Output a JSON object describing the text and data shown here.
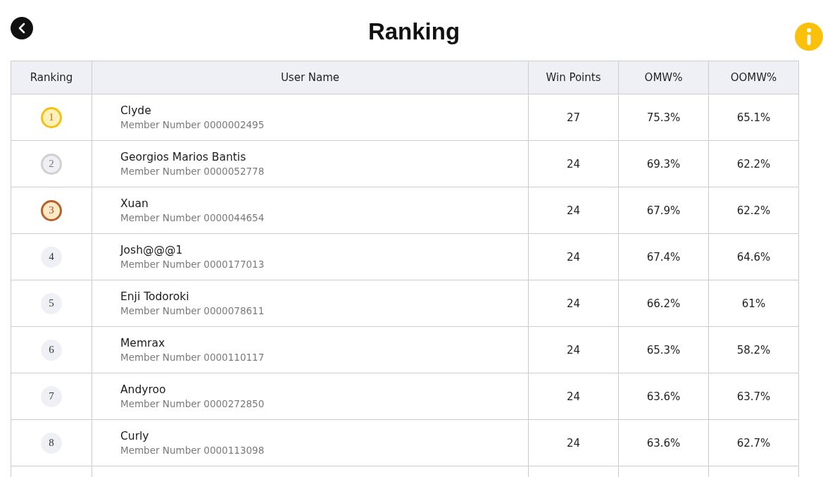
{
  "title": "Ranking",
  "table": {
    "columns": [
      "Ranking",
      "User Name",
      "Win Points",
      "OMW%",
      "OOMW%"
    ],
    "rows": [
      {
        "rank": "1",
        "kind": "gold",
        "name": "Clyde",
        "member": "Member Number 0000002495",
        "win_points": "27",
        "omw": "75.3%",
        "oomw": "65.1%"
      },
      {
        "rank": "2",
        "kind": "silver",
        "name": "Georgios Marios Bantis",
        "member": "Member Number 0000052778",
        "win_points": "24",
        "omw": "69.3%",
        "oomw": "62.2%"
      },
      {
        "rank": "3",
        "kind": "bronze",
        "name": "Xuan",
        "member": "Member Number 0000044654",
        "win_points": "24",
        "omw": "67.9%",
        "oomw": "62.2%"
      },
      {
        "rank": "4",
        "kind": "plain",
        "name": "Josh@@@1",
        "member": "Member Number 0000177013",
        "win_points": "24",
        "omw": "67.4%",
        "oomw": "64.6%"
      },
      {
        "rank": "5",
        "kind": "plain",
        "name": "Enji Todoroki",
        "member": "Member Number 0000078611",
        "win_points": "24",
        "omw": "66.2%",
        "oomw": "61%"
      },
      {
        "rank": "6",
        "kind": "plain",
        "name": "Memrax",
        "member": "Member Number 0000110117",
        "win_points": "24",
        "omw": "65.3%",
        "oomw": "58.2%"
      },
      {
        "rank": "7",
        "kind": "plain",
        "name": "Andyroo",
        "member": "Member Number 0000272850",
        "win_points": "24",
        "omw": "63.6%",
        "oomw": "63.7%"
      },
      {
        "rank": "8",
        "kind": "plain",
        "name": "Curly",
        "member": "Member Number 0000113098",
        "win_points": "24",
        "omw": "63.6%",
        "oomw": "62.7%"
      }
    ]
  }
}
